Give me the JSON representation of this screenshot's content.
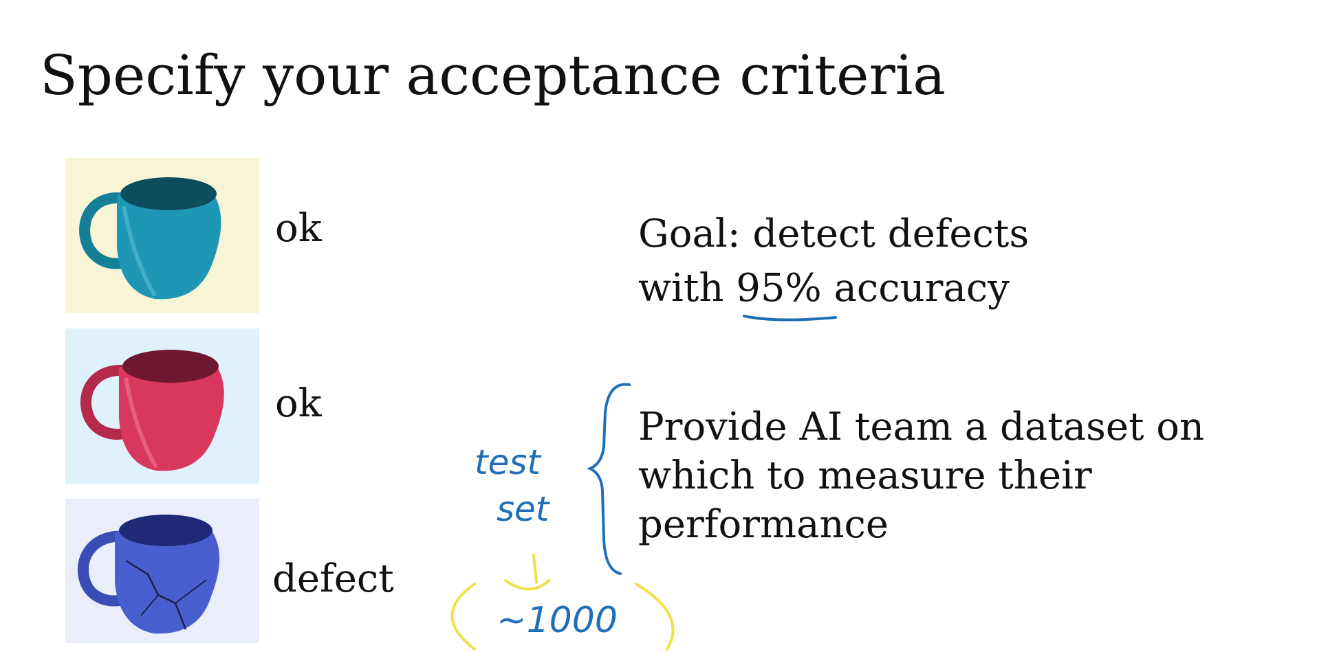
{
  "slide": {
    "title": "Specify your acceptance criteria",
    "examples": [
      {
        "label": "ok",
        "icon": "mug-icon",
        "color": "#1d97b3",
        "background": "#f7f5d6"
      },
      {
        "label": "ok",
        "icon": "mug-icon",
        "color": "#d8375e",
        "background": "#dff2fb"
      },
      {
        "label": "defect",
        "icon": "cracked-mug-icon",
        "color": "#4a5fcf",
        "background": "#eaeefb"
      }
    ],
    "goal": {
      "prefix": "Goal: detect defects",
      "line2_before": "with ",
      "highlight": "95%",
      "line2_after": " accuracy"
    },
    "provide": {
      "lines": [
        "Provide AI team a dataset on",
        "which to measure their",
        "performance"
      ]
    },
    "annotations": {
      "ink_color": "#1f6fb8",
      "highlight_color": "#f1e04a",
      "test_word": "test",
      "set_word": "set",
      "size_note": "~1000"
    }
  }
}
